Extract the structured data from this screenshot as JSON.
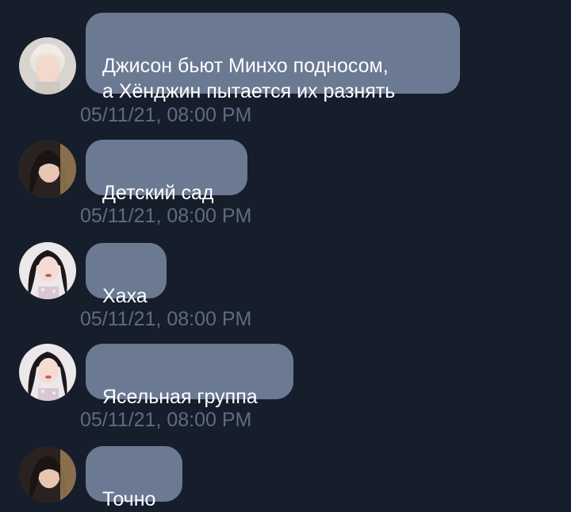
{
  "messages": [
    {
      "avatar": "avatar-light-hair",
      "text": "Джисон бьют Минхо подносом,\nа Хёнджин пытается их разнять",
      "time": "05/11/21, 08:00 PM"
    },
    {
      "avatar": "avatar-dark-hair",
      "text": "Детский сад",
      "time": "05/11/21, 08:00 PM"
    },
    {
      "avatar": "avatar-dark-hair-pink",
      "text": "Хаха",
      "time": "05/11/21, 08:00 PM"
    },
    {
      "avatar": "avatar-dark-hair-pink",
      "text": "Ясельная группа",
      "time": "05/11/21, 08:00 PM"
    },
    {
      "avatar": "avatar-dark-hair",
      "text": "Точно",
      "time": null
    }
  ],
  "colors": {
    "background": "#161d2b",
    "bubble": "#6b7a92",
    "timestamp": "#5f6b80",
    "message_text": "#ffffff"
  }
}
